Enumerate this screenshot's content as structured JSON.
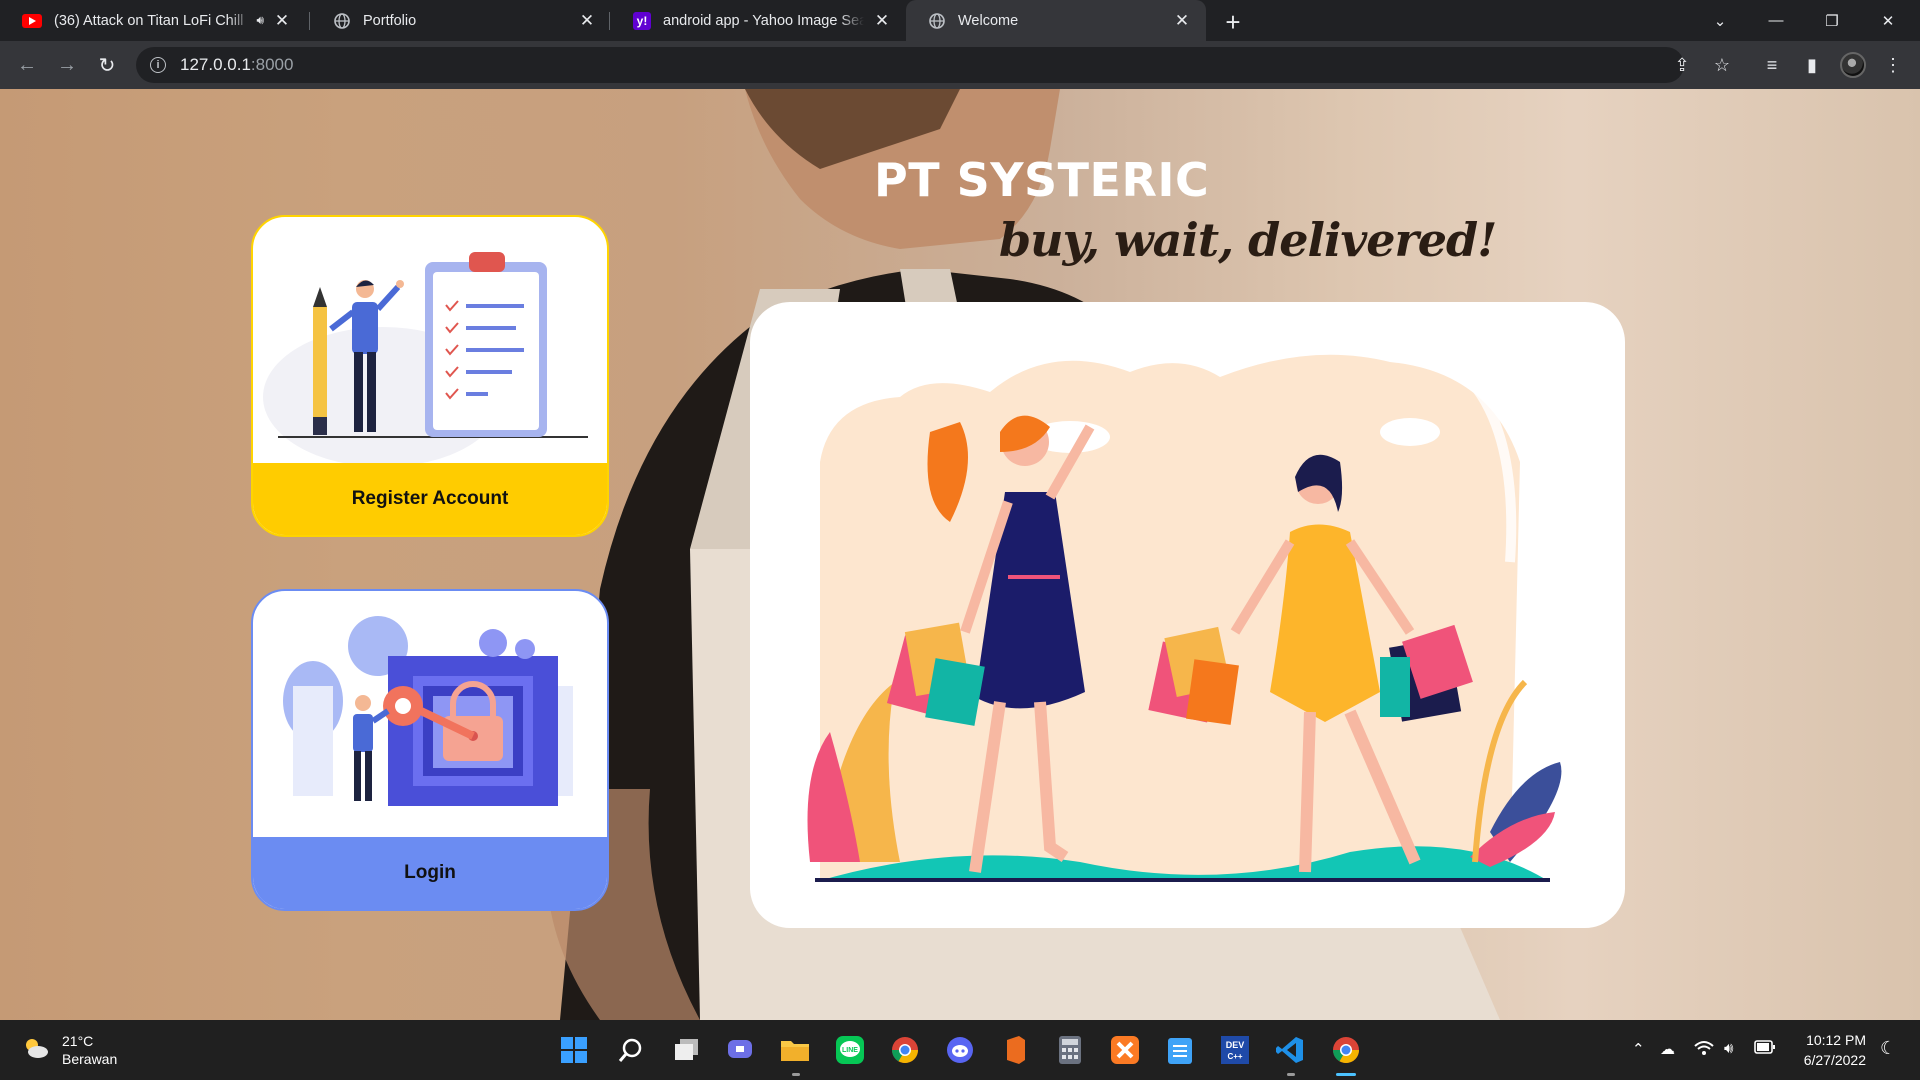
{
  "browser": {
    "tabs": [
      {
        "title": "(36) Attack on Titan LoFi Chill",
        "favicon": "youtube-icon",
        "audio": true,
        "active": false
      },
      {
        "title": "Portfolio",
        "favicon": "globe-icon",
        "active": false
      },
      {
        "title": "android app - Yahoo Image Search",
        "favicon": "yahoo-icon",
        "active": false
      },
      {
        "title": "Welcome",
        "favicon": "globe-icon",
        "active": true
      }
    ],
    "url_host": "127.0.0.1",
    "url_port": ":8000"
  },
  "page": {
    "brand": "PT SYSTERIC",
    "tagline": "buy, wait, delivered!",
    "register_label": "Register Account",
    "login_label": "Login",
    "colors": {
      "register": "#ffcc00",
      "login": "#6b8cf2"
    }
  },
  "taskbar": {
    "temperature": "21°C",
    "weather": "Berawan",
    "time": "10:12 PM",
    "date": "6/27/2022",
    "apps": [
      "windows-start-icon",
      "search-icon",
      "task-view-icon",
      "teams-chat-icon",
      "file-explorer-icon",
      "line-icon",
      "chrome-icon",
      "discord-icon",
      "office-icon",
      "calculator-icon",
      "xampp-icon",
      "notepad-icon",
      "devcpp-icon",
      "vscode-icon",
      "chrome-active-icon"
    ]
  }
}
